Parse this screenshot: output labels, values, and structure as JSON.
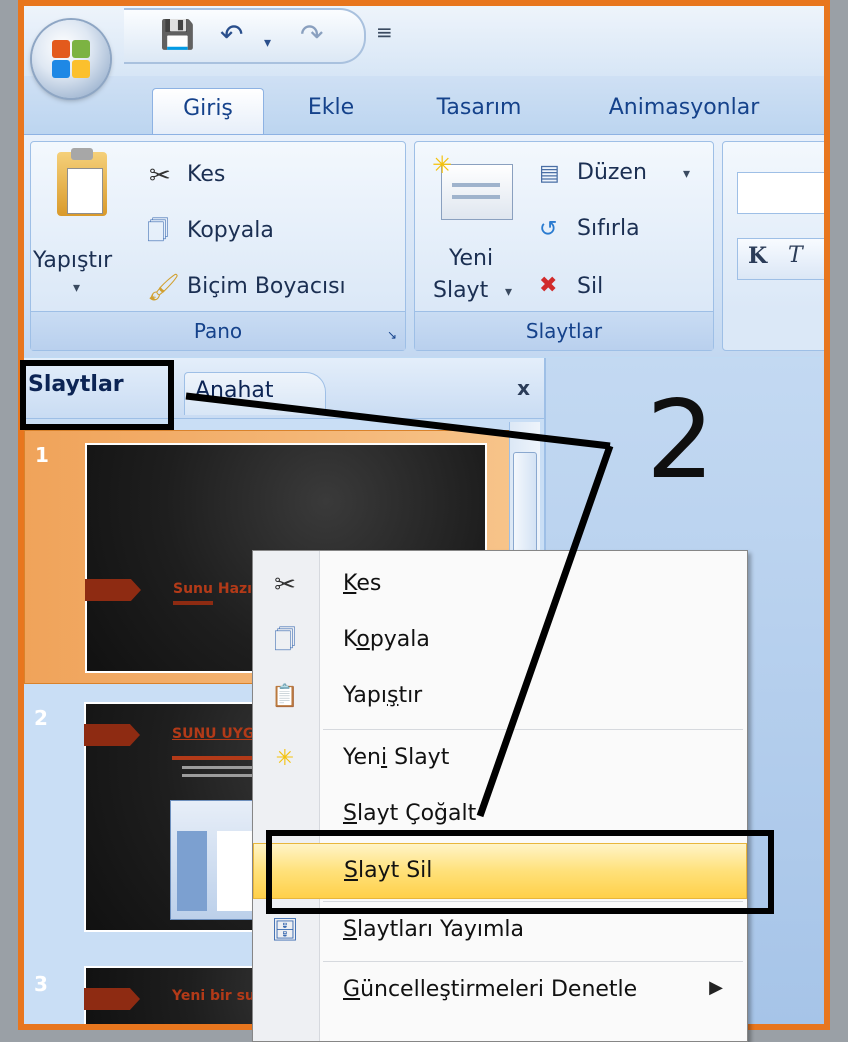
{
  "qat": {
    "save_icon": "save-icon",
    "undo_icon": "undo-icon",
    "redo_icon": "redo-icon",
    "customize": "₹"
  },
  "tabs": [
    {
      "label": "Giriş"
    },
    {
      "label": "Ekle"
    },
    {
      "label": "Tasarım"
    },
    {
      "label": "Animasyonlar"
    }
  ],
  "ribbon": {
    "clipboard": {
      "paste": "Yapıştır",
      "cut": "Kes",
      "copy": "Kopyala",
      "format_painter": "Biçim Boyacısı",
      "label": "Pano"
    },
    "slides": {
      "new_slide_line1": "Yeni",
      "new_slide_line2": "Slayt",
      "layout": "Düzen",
      "reset": "Sıfırla",
      "delete": "Sil",
      "label": "Slaytlar"
    },
    "font": {
      "bold": "K",
      "italic": "T"
    }
  },
  "pane": {
    "tab_slides": "Slaytlar",
    "tab_outline": "Anahat",
    "close": "x",
    "slides": [
      {
        "num": "1",
        "title": "Sunu Hazı"
      },
      {
        "num": "2",
        "title": "SUNU UYGULA"
      },
      {
        "num": "3",
        "title": "Yeni bir sunu"
      }
    ]
  },
  "callout": {
    "label": "2"
  },
  "context_menu": {
    "items": [
      {
        "pre": "",
        "u": "K",
        "post": "es"
      },
      {
        "pre": "K",
        "u": "o",
        "post": "pyala"
      },
      {
        "pre": "Yapı",
        "u": "ş",
        "post": "tır"
      },
      {
        "pre": "Yen",
        "u": "i",
        "post": " Slayt"
      },
      {
        "pre": "",
        "u": "S",
        "post": "layt Çoğalt"
      },
      {
        "pre": "",
        "u": "S",
        "post": "layt Sil"
      },
      {
        "pre": "",
        "u": "S",
        "post": "laytları Yayımla"
      },
      {
        "pre": "",
        "u": "G",
        "post": "üncelleştirmeleri Denetle"
      }
    ]
  },
  "colors": {
    "frame": "#e8761e",
    "highlight": "#ffd04a",
    "slide_tag": "#8e2b12",
    "ribbon_text": "#15428b"
  }
}
